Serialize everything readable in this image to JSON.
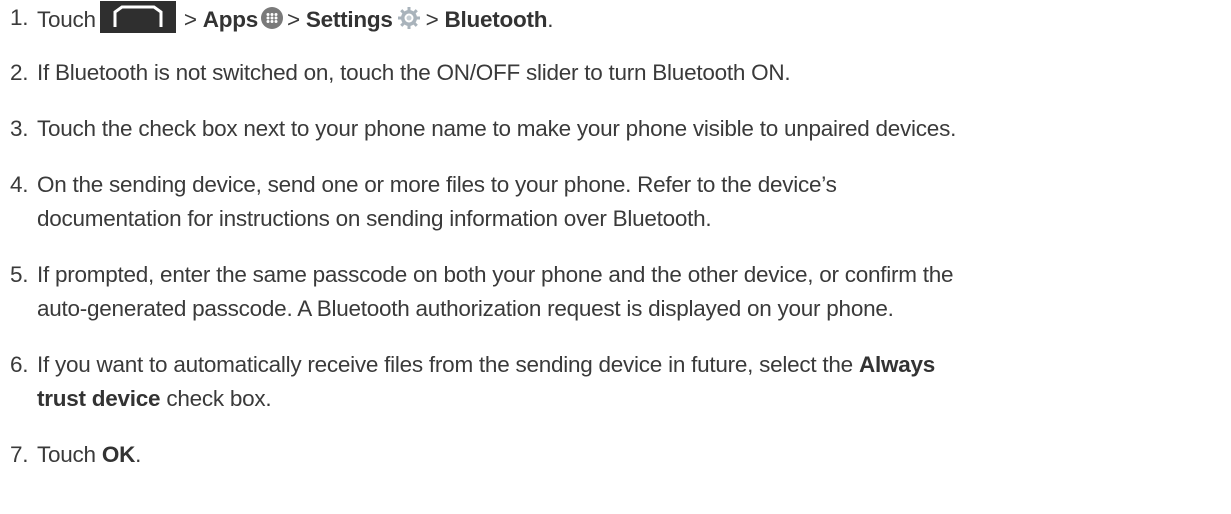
{
  "steps": [
    {
      "num": "1.",
      "parts": {
        "touch": "Touch",
        "sep1": ">",
        "apps": "Apps",
        "sep2": ">",
        "settings": "Settings",
        "sep3": ">",
        "bluetooth": "Bluetooth",
        "end": "."
      }
    },
    {
      "num": "2.",
      "text": "If Bluetooth is not switched on, touch the ON/OFF slider to turn Bluetooth ON."
    },
    {
      "num": "3.",
      "text": "Touch the check box next to your phone name to make your phone visible to unpaired devices."
    },
    {
      "num": "4.",
      "line1": "On the sending device, send one or more files to your phone. Refer to the device’s",
      "line2": "documentation for instructions on sending information over Bluetooth."
    },
    {
      "num": "5.",
      "line1": "If prompted, enter the same passcode on both your phone and the other device, or confirm the",
      "line2": "auto-generated passcode. A Bluetooth authorization request is displayed on your phone."
    },
    {
      "num": "6.",
      "line1_pre": "If you want to automatically receive files from the sending device in future, select the",
      "line1_bold": "Always",
      "line2_bold": "trust device",
      "line2_post": "check box."
    },
    {
      "num": "7.",
      "pre": "Touch",
      "bold": "OK",
      "end": "."
    }
  ],
  "icons": {
    "home": "home-button-icon",
    "apps": "apps-icon",
    "settings": "settings-gear-icon"
  },
  "colors": {
    "text": "#3a3a3a",
    "home_icon_bg": "#2f2f2f",
    "apps_icon_bg": "#7a7a7a",
    "gear_icon": "#a9b3bb"
  }
}
